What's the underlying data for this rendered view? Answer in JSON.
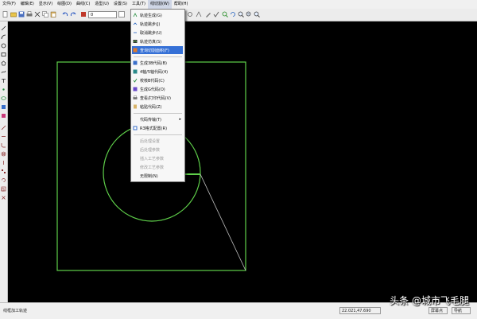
{
  "menubar": {
    "items": [
      {
        "label": "文件(F)"
      },
      {
        "label": "编辑(E)"
      },
      {
        "label": "显示(V)"
      },
      {
        "label": "绘图(D)"
      },
      {
        "label": "曲线(C)"
      },
      {
        "label": "造型(U)"
      },
      {
        "label": "设置(S)"
      },
      {
        "label": "工具(T)"
      },
      {
        "label": "线切割(W)"
      },
      {
        "label": "帮助(H)"
      }
    ]
  },
  "toolbar": {
    "layer_value": "0"
  },
  "dropdown": {
    "items": [
      {
        "label": "轨迹生成(G)",
        "icon": "trajectory-generate",
        "enabled": true
      },
      {
        "label": "轨迹跳步(J)",
        "icon": "trajectory-skip",
        "enabled": true
      },
      {
        "label": "取消跳步(U)",
        "icon": "cancel-skip",
        "enabled": true
      },
      {
        "label": "轨迹仿真(S)",
        "icon": "trajectory-simulate",
        "enabled": true
      },
      {
        "label": "查询切割面积(F)",
        "icon": "query-area",
        "enabled": true,
        "highlighted": true
      },
      {
        "label": "生成3B代码(B)",
        "icon": "generate-3b",
        "enabled": true
      },
      {
        "label": "4轴/5轴代码(4)",
        "icon": "code-4axis",
        "enabled": true
      },
      {
        "label": "校核B代码(C)",
        "icon": "check-b-code",
        "enabled": true
      },
      {
        "label": "生成G代码(O)",
        "icon": "generate-g",
        "enabled": true
      },
      {
        "label": "查看/打印代码(V)",
        "icon": "view-print-code",
        "enabled": true
      },
      {
        "label": "粘贴代码(Z)",
        "icon": "paste-code",
        "enabled": true
      },
      {
        "label": "代码传输(T)",
        "icon": "code-transfer",
        "enabled": true,
        "submenu": true
      },
      {
        "label": "R3格式配置(R)",
        "icon": "r3-config",
        "enabled": true
      },
      {
        "label": "后处理设置",
        "enabled": false
      },
      {
        "label": "后处理参数",
        "enabled": false
      },
      {
        "label": "插入工艺参数",
        "enabled": false
      },
      {
        "label": "修改工艺参数",
        "enabled": false
      },
      {
        "label": "无限制(N)",
        "enabled": true
      }
    ]
  },
  "statusbar": {
    "left_text": "线框加工轨迹",
    "coordinates": "22.021,47.690",
    "mode": "屏幕点",
    "state": "导航"
  },
  "watermark": {
    "text": "头条 @城市飞毛腿"
  },
  "colors": {
    "canvas": "#000000",
    "geometry": "#5fd04a",
    "tangent_line": "#bfbfbf",
    "highlight": "#3570d6"
  }
}
